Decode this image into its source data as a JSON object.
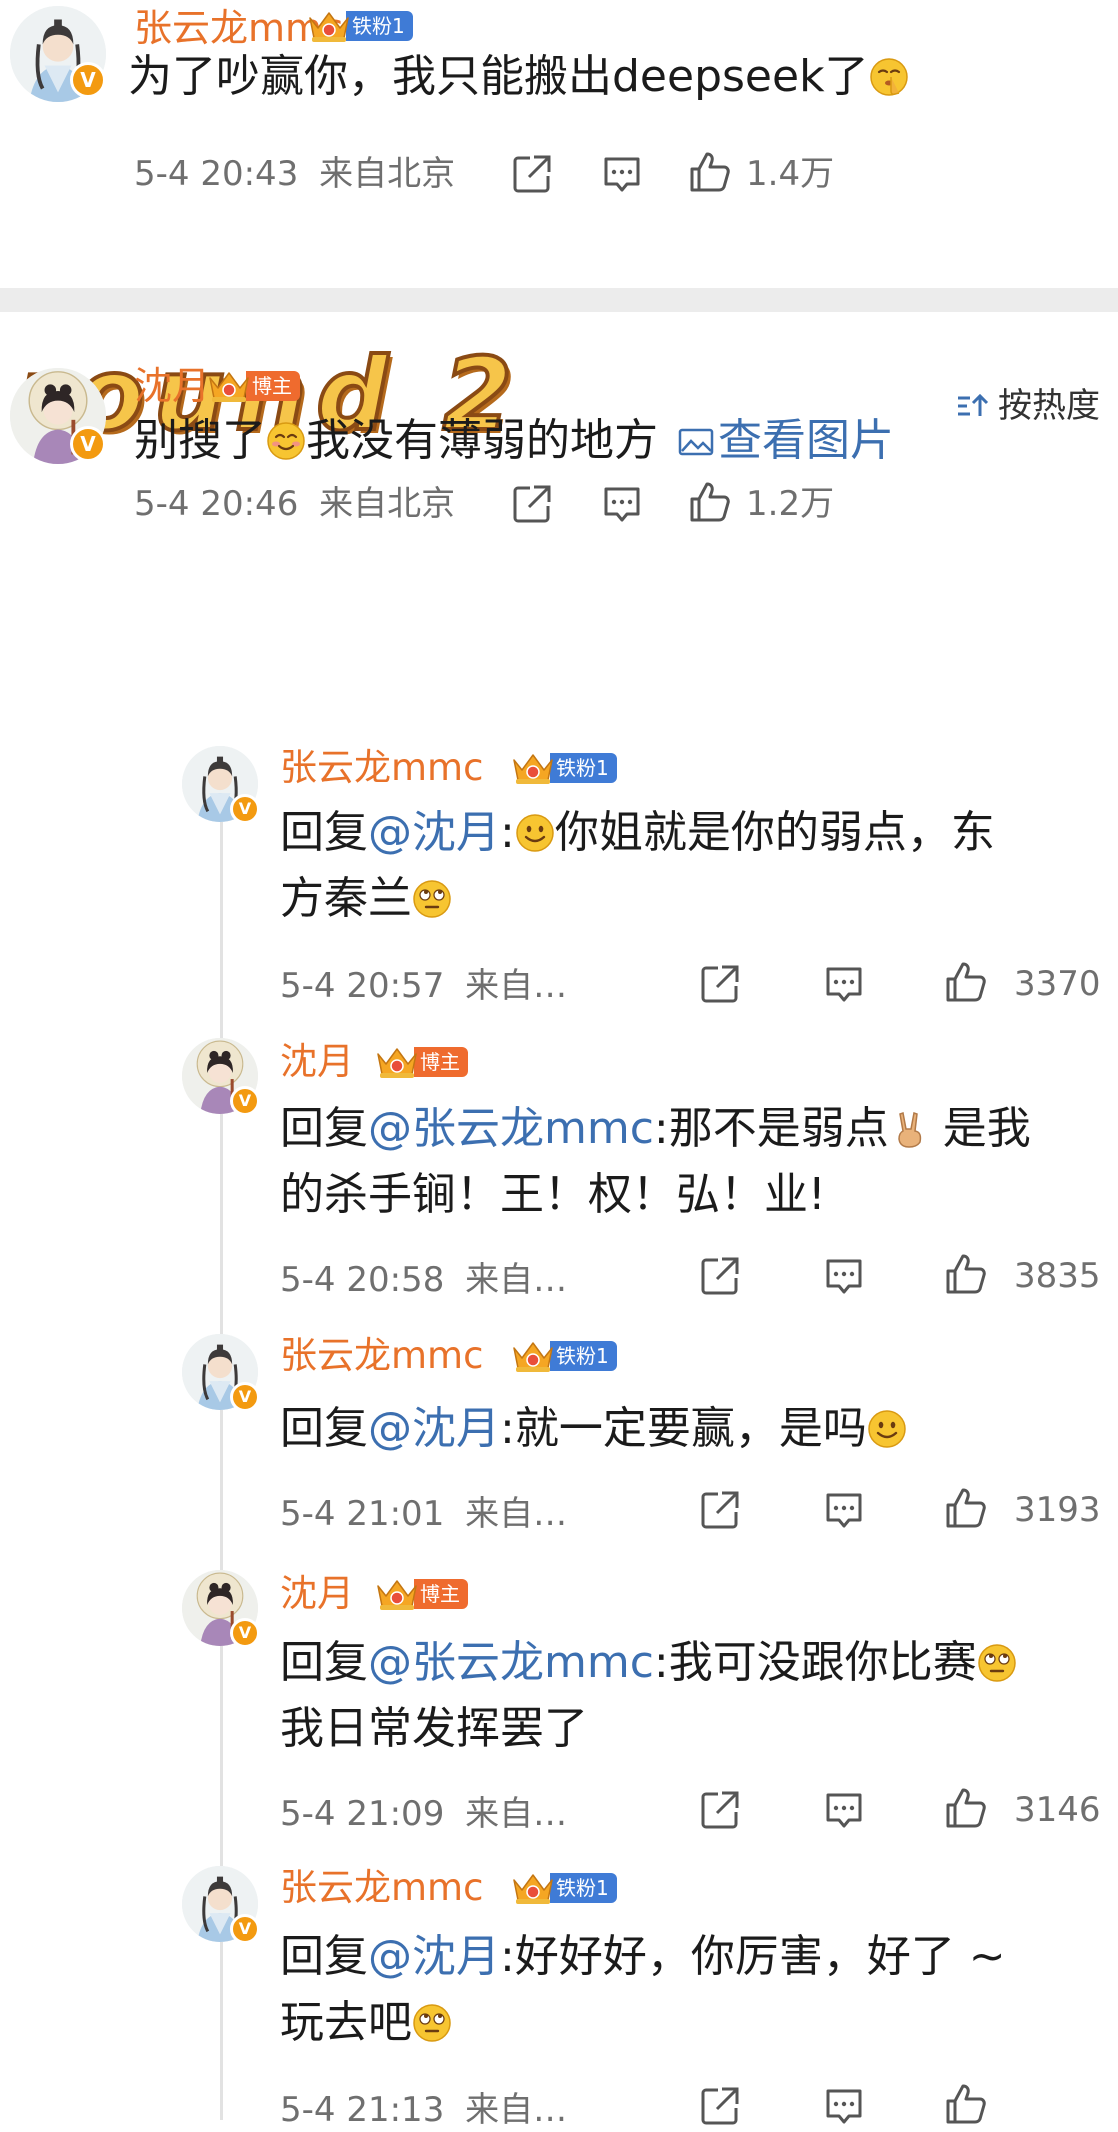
{
  "comments": [
    {
      "author": "张云龙mmc",
      "badge": "铁粉1",
      "text": "为了吵赢你，我只能搬出deepseek了",
      "time": "5-4 20:43",
      "location": "来自北京",
      "likes": "1.4万"
    }
  ],
  "round_title": "round 2",
  "sort_label": "按热度",
  "main_comment": {
    "author": "沈月",
    "badge": "博主",
    "text_a": "别搜了",
    "text_b": "我没有薄弱的地方",
    "view_image": "查看图片",
    "time": "5-4 20:46",
    "location": "来自北京",
    "likes": "1.2万"
  },
  "replies": [
    {
      "author": "张云龙mmc",
      "badge": "铁粉1",
      "prefix": "回复",
      "mention": "@沈月",
      "line1": ":",
      "line1b": "你姐就是你的弱点，东",
      "line2": "方秦兰",
      "time": "5-4 20:57",
      "location": "来自…",
      "likes": "3370"
    },
    {
      "author": "沈月",
      "badge": "博主",
      "prefix": "回复",
      "mention": "@张云龙mmc",
      "line1": ":那不是弱点",
      "line1b": " 是我",
      "line2": "的杀手锏！王！权！弘！业!",
      "time": "5-4 20:58",
      "location": "来自…",
      "likes": "3835"
    },
    {
      "author": "张云龙mmc",
      "badge": "铁粉1",
      "prefix": "回复",
      "mention": "@沈月",
      "line1": ":就一定要赢，是吗",
      "time": "5-4 21:01",
      "location": "来自…",
      "likes": "3193"
    },
    {
      "author": "沈月",
      "badge": "博主",
      "prefix": "回复",
      "mention": "@张云龙mmc",
      "line1": ":我可没跟你比赛",
      "line2": "我日常发挥罢了",
      "time": "5-4 21:09",
      "location": "来自…",
      "likes": "3146"
    },
    {
      "author": "张云龙mmc",
      "badge": "铁粉1",
      "prefix": "回复",
      "mention": "@沈月",
      "line1": ":好好好，你厉害，好了 ~",
      "line2": "玩去吧",
      "time": "5-4 21:13",
      "location": "来自…"
    }
  ],
  "icons": {
    "verified": "V",
    "share": "share-icon",
    "comment": "comment-icon",
    "like": "like-icon",
    "emoji_shh": "shush-emoji",
    "emoji_smile": "smile-emoji",
    "emoji_eyeroll": "eyeroll-emoji",
    "emoji_victory": "victory-hand-emoji"
  },
  "colors": {
    "name": "#e8722a",
    "mention": "#3c6fb0",
    "iron_badge": "#3f7bd6",
    "host_badge": "#ef6b2e",
    "verified": "#f39a10"
  }
}
